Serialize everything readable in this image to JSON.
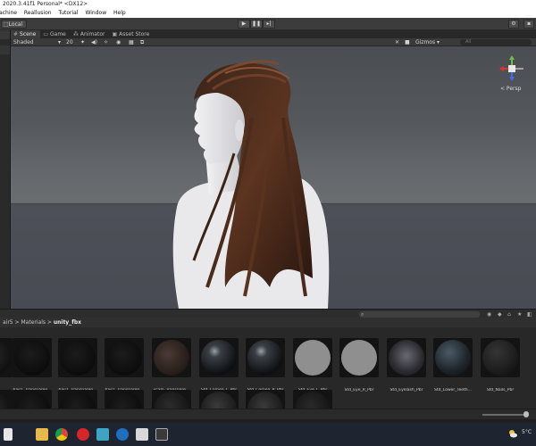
{
  "window": {
    "title": "2020.3.41f1 Personal* <DX12>"
  },
  "menu": [
    "achine",
    "Reallusion",
    "Tutorial",
    "Window",
    "Help"
  ],
  "toolbar": {
    "local_label": "Local"
  },
  "tabs": [
    {
      "label": "Scene",
      "icon": "hash-icon",
      "active": true
    },
    {
      "label": "Game",
      "icon": "gamepad-icon",
      "active": false
    },
    {
      "label": "Animator",
      "icon": "animator-icon",
      "active": false
    },
    {
      "label": "Asset Store",
      "icon": "store-icon",
      "active": false
    }
  ],
  "scene_toolbar": {
    "shading": "Shaded",
    "grid_value": "20",
    "gizmos_label": "Gizmos",
    "search_placeholder": "All"
  },
  "viewport": {
    "projection_label": "< Persp"
  },
  "project": {
    "breadcrumb": [
      "air5",
      "Materials"
    ],
    "breadcrumb_current": "unity_fbx",
    "assets_row1": [
      {
        "label": "",
        "thumb": "dark-partial"
      },
      {
        "label": "hair1_Transparen...",
        "thumb": "dark"
      },
      {
        "label": "hair1_Transparen...",
        "thumb": "dark"
      },
      {
        "label": "hair1_Transparen...",
        "thumb": "dark"
      },
      {
        "label": "scalp_Transpare...",
        "thumb": "scalp"
      },
      {
        "label": "Std_Cornea_L_Pbr",
        "thumb": "glass"
      },
      {
        "label": "Std_Cornea_R_Pbr",
        "thumb": "glass"
      },
      {
        "label": "Std_Eye_L_Pbr",
        "thumb": "grey"
      },
      {
        "label": "Std_Eye_R_Pbr",
        "thumb": "grey"
      },
      {
        "label": "Std_Eyelash_Pbr",
        "thumb": "eyelash"
      },
      {
        "label": "Std_Lower_Teeth...",
        "thumb": "teeth"
      },
      {
        "label": "Std_Nails_Pbr",
        "thumb": "nails"
      }
    ]
  },
  "taskbar": {
    "temperature": "5°C"
  },
  "colors": {
    "accent_blue": "#3a79d8",
    "gizmo_red": "#d9352b",
    "gizmo_green": "#6cc04a",
    "gizmo_blue": "#3d6cf0"
  }
}
